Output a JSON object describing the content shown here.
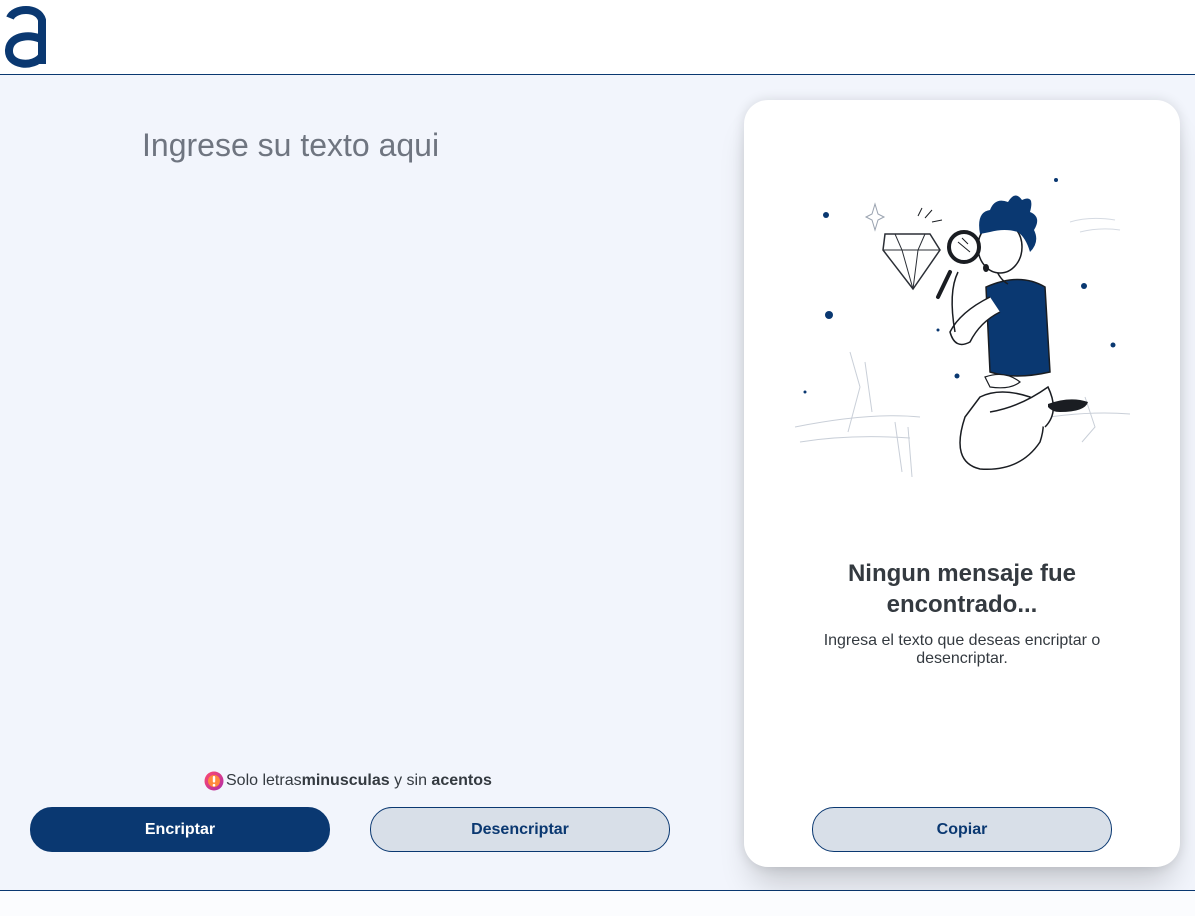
{
  "header": {
    "logo_icon": "alura-a-logo-icon"
  },
  "input": {
    "placeholder": "Ingrese su texto aqui"
  },
  "warning": {
    "icon": "exclamation-badge-icon",
    "prefix": "Solo letras ",
    "bold1": "minusculas",
    "middle": " y sin ",
    "bold2": "acentos"
  },
  "actions": {
    "encrypt_label": "Encriptar",
    "decrypt_label": "Desencriptar"
  },
  "output": {
    "illustration": "person-with-magnifying-glass-illustration",
    "empty_title": "Ningun mensaje fue encontrado...",
    "empty_text": "Ingresa el texto que deseas encriptar o desencriptar.",
    "copy_label": "Copiar"
  },
  "colors": {
    "primary": "#0a3871",
    "background": "#f2f5fc",
    "secondary_button": "#d8dfe8",
    "text_dark": "#343a40"
  }
}
